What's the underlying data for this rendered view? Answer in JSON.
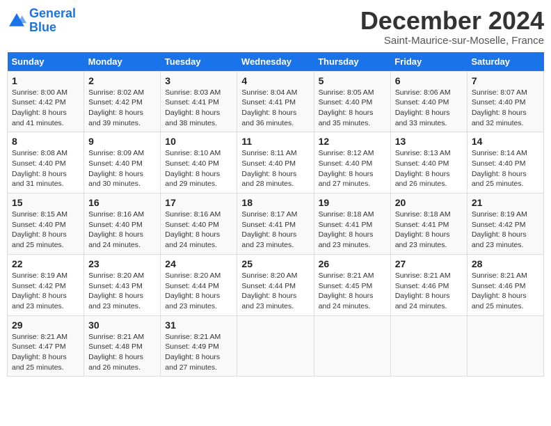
{
  "header": {
    "logo_line1": "General",
    "logo_line2": "Blue",
    "month_title": "December 2024",
    "location": "Saint-Maurice-sur-Moselle, France"
  },
  "days_of_week": [
    "Sunday",
    "Monday",
    "Tuesday",
    "Wednesday",
    "Thursday",
    "Friday",
    "Saturday"
  ],
  "weeks": [
    [
      {
        "day": 1,
        "sunrise": "8:00 AM",
        "sunset": "4:42 PM",
        "daylight": "8 hours and 41 minutes."
      },
      {
        "day": 2,
        "sunrise": "8:02 AM",
        "sunset": "4:42 PM",
        "daylight": "8 hours and 39 minutes."
      },
      {
        "day": 3,
        "sunrise": "8:03 AM",
        "sunset": "4:41 PM",
        "daylight": "8 hours and 38 minutes."
      },
      {
        "day": 4,
        "sunrise": "8:04 AM",
        "sunset": "4:41 PM",
        "daylight": "8 hours and 36 minutes."
      },
      {
        "day": 5,
        "sunrise": "8:05 AM",
        "sunset": "4:40 PM",
        "daylight": "8 hours and 35 minutes."
      },
      {
        "day": 6,
        "sunrise": "8:06 AM",
        "sunset": "4:40 PM",
        "daylight": "8 hours and 33 minutes."
      },
      {
        "day": 7,
        "sunrise": "8:07 AM",
        "sunset": "4:40 PM",
        "daylight": "8 hours and 32 minutes."
      }
    ],
    [
      {
        "day": 8,
        "sunrise": "8:08 AM",
        "sunset": "4:40 PM",
        "daylight": "8 hours and 31 minutes."
      },
      {
        "day": 9,
        "sunrise": "8:09 AM",
        "sunset": "4:40 PM",
        "daylight": "8 hours and 30 minutes."
      },
      {
        "day": 10,
        "sunrise": "8:10 AM",
        "sunset": "4:40 PM",
        "daylight": "8 hours and 29 minutes."
      },
      {
        "day": 11,
        "sunrise": "8:11 AM",
        "sunset": "4:40 PM",
        "daylight": "8 hours and 28 minutes."
      },
      {
        "day": 12,
        "sunrise": "8:12 AM",
        "sunset": "4:40 PM",
        "daylight": "8 hours and 27 minutes."
      },
      {
        "day": 13,
        "sunrise": "8:13 AM",
        "sunset": "4:40 PM",
        "daylight": "8 hours and 26 minutes."
      },
      {
        "day": 14,
        "sunrise": "8:14 AM",
        "sunset": "4:40 PM",
        "daylight": "8 hours and 25 minutes."
      }
    ],
    [
      {
        "day": 15,
        "sunrise": "8:15 AM",
        "sunset": "4:40 PM",
        "daylight": "8 hours and 25 minutes."
      },
      {
        "day": 16,
        "sunrise": "8:16 AM",
        "sunset": "4:40 PM",
        "daylight": "8 hours and 24 minutes."
      },
      {
        "day": 17,
        "sunrise": "8:16 AM",
        "sunset": "4:40 PM",
        "daylight": "8 hours and 24 minutes."
      },
      {
        "day": 18,
        "sunrise": "8:17 AM",
        "sunset": "4:41 PM",
        "daylight": "8 hours and 23 minutes."
      },
      {
        "day": 19,
        "sunrise": "8:18 AM",
        "sunset": "4:41 PM",
        "daylight": "8 hours and 23 minutes."
      },
      {
        "day": 20,
        "sunrise": "8:18 AM",
        "sunset": "4:41 PM",
        "daylight": "8 hours and 23 minutes."
      },
      {
        "day": 21,
        "sunrise": "8:19 AM",
        "sunset": "4:42 PM",
        "daylight": "8 hours and 23 minutes."
      }
    ],
    [
      {
        "day": 22,
        "sunrise": "8:19 AM",
        "sunset": "4:42 PM",
        "daylight": "8 hours and 23 minutes."
      },
      {
        "day": 23,
        "sunrise": "8:20 AM",
        "sunset": "4:43 PM",
        "daylight": "8 hours and 23 minutes."
      },
      {
        "day": 24,
        "sunrise": "8:20 AM",
        "sunset": "4:44 PM",
        "daylight": "8 hours and 23 minutes."
      },
      {
        "day": 25,
        "sunrise": "8:20 AM",
        "sunset": "4:44 PM",
        "daylight": "8 hours and 23 minutes."
      },
      {
        "day": 26,
        "sunrise": "8:21 AM",
        "sunset": "4:45 PM",
        "daylight": "8 hours and 24 minutes."
      },
      {
        "day": 27,
        "sunrise": "8:21 AM",
        "sunset": "4:46 PM",
        "daylight": "8 hours and 24 minutes."
      },
      {
        "day": 28,
        "sunrise": "8:21 AM",
        "sunset": "4:46 PM",
        "daylight": "8 hours and 25 minutes."
      }
    ],
    [
      {
        "day": 29,
        "sunrise": "8:21 AM",
        "sunset": "4:47 PM",
        "daylight": "8 hours and 25 minutes."
      },
      {
        "day": 30,
        "sunrise": "8:21 AM",
        "sunset": "4:48 PM",
        "daylight": "8 hours and 26 minutes."
      },
      {
        "day": 31,
        "sunrise": "8:21 AM",
        "sunset": "4:49 PM",
        "daylight": "8 hours and 27 minutes."
      },
      null,
      null,
      null,
      null
    ]
  ],
  "labels": {
    "sunrise": "Sunrise:",
    "sunset": "Sunset:",
    "daylight": "Daylight:"
  }
}
